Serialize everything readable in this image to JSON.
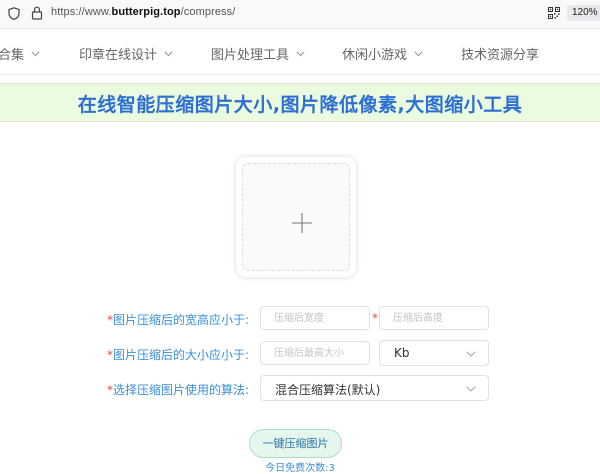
{
  "browser": {
    "url_prefix": "https://www.",
    "url_domain": "butterpig.top",
    "url_path": "/compress/",
    "zoom": "120%"
  },
  "nav": {
    "items": [
      {
        "label": "合集"
      },
      {
        "label": "印章在线设计"
      },
      {
        "label": "图片处理工具"
      },
      {
        "label": "休闲小游戏"
      },
      {
        "label": "技术资源分享"
      }
    ]
  },
  "banner": {
    "title": "在线智能压缩图片大小,图片降低像素,大图缩小工具"
  },
  "upload": {
    "icon": "plus-icon"
  },
  "form": {
    "required_mark": "*",
    "size_label": "图片压缩后的宽高应小于:",
    "width_placeholder": "压缩后宽度",
    "height_placeholder": "压缩后高度",
    "filesize_label": "图片压缩后的大小应小于:",
    "filesize_placeholder": "压缩后最高大小",
    "unit_value": "Kb",
    "algorithm_label": "选择压缩图片使用的算法:",
    "algorithm_value": "混合压缩算法(默认)"
  },
  "actions": {
    "compress_button": "一键压缩图片",
    "free_count_text": "今日免费次数:3"
  },
  "colors": {
    "banner_bg": "#eafbe0",
    "title_blue": "#2e6fd3",
    "label_blue": "#3b8fd8",
    "required_red": "#e84a4a",
    "button_bg": "#e5f7ec"
  }
}
